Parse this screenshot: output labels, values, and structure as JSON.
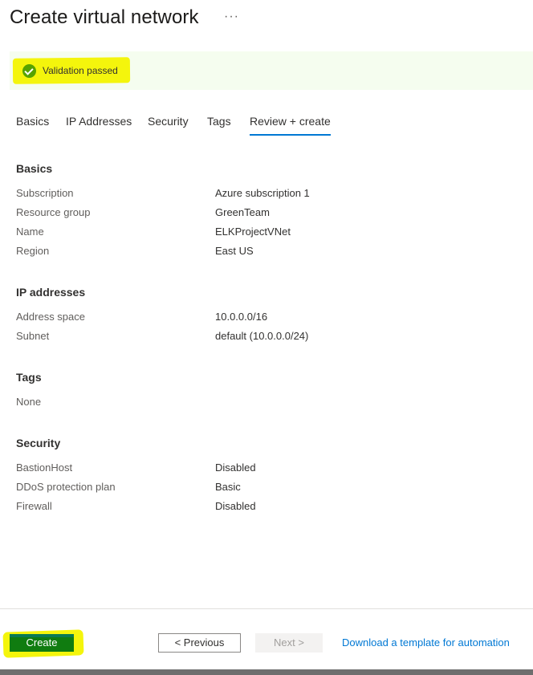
{
  "header": {
    "title": "Create virtual network",
    "more_icon": "more-horizontal-icon",
    "more_glyph": "···"
  },
  "validation": {
    "icon": "check-circle-icon",
    "text": "Validation passed",
    "colors": {
      "bar_bg": "#f5fdef",
      "highlight": "#f4f50c",
      "check": "#57a300"
    }
  },
  "tabs": [
    {
      "label": "Basics",
      "active": false
    },
    {
      "label": "IP Addresses",
      "active": false
    },
    {
      "label": "Security",
      "active": false
    },
    {
      "label": "Tags",
      "active": false
    },
    {
      "label": "Review + create",
      "active": true
    }
  ],
  "sections": {
    "basics": {
      "title": "Basics",
      "rows": [
        {
          "label": "Subscription",
          "value": "Azure subscription 1"
        },
        {
          "label": "Resource group",
          "value": "GreenTeam"
        },
        {
          "label": "Name",
          "value": "ELKProjectVNet"
        },
        {
          "label": "Region",
          "value": "East US"
        }
      ]
    },
    "ip_addresses": {
      "title": "IP addresses",
      "rows": [
        {
          "label": "Address space",
          "value": "10.0.0.0/16"
        },
        {
          "label": "Subnet",
          "value": "default (10.0.0.0/24)"
        }
      ]
    },
    "tags": {
      "title": "Tags",
      "rows": [
        {
          "label": "None",
          "value": ""
        }
      ]
    },
    "security": {
      "title": "Security",
      "rows": [
        {
          "label": "BastionHost",
          "value": "Disabled"
        },
        {
          "label": "DDoS protection plan",
          "value": "Basic"
        },
        {
          "label": "Firewall",
          "value": "Disabled"
        }
      ]
    }
  },
  "footer": {
    "create_label": "Create",
    "previous_label": "< Previous",
    "next_label": "Next >",
    "template_link": "Download a template for automation",
    "colors": {
      "create_bg": "#107c10",
      "link": "#0078d4",
      "accent": "#0078d4"
    }
  }
}
